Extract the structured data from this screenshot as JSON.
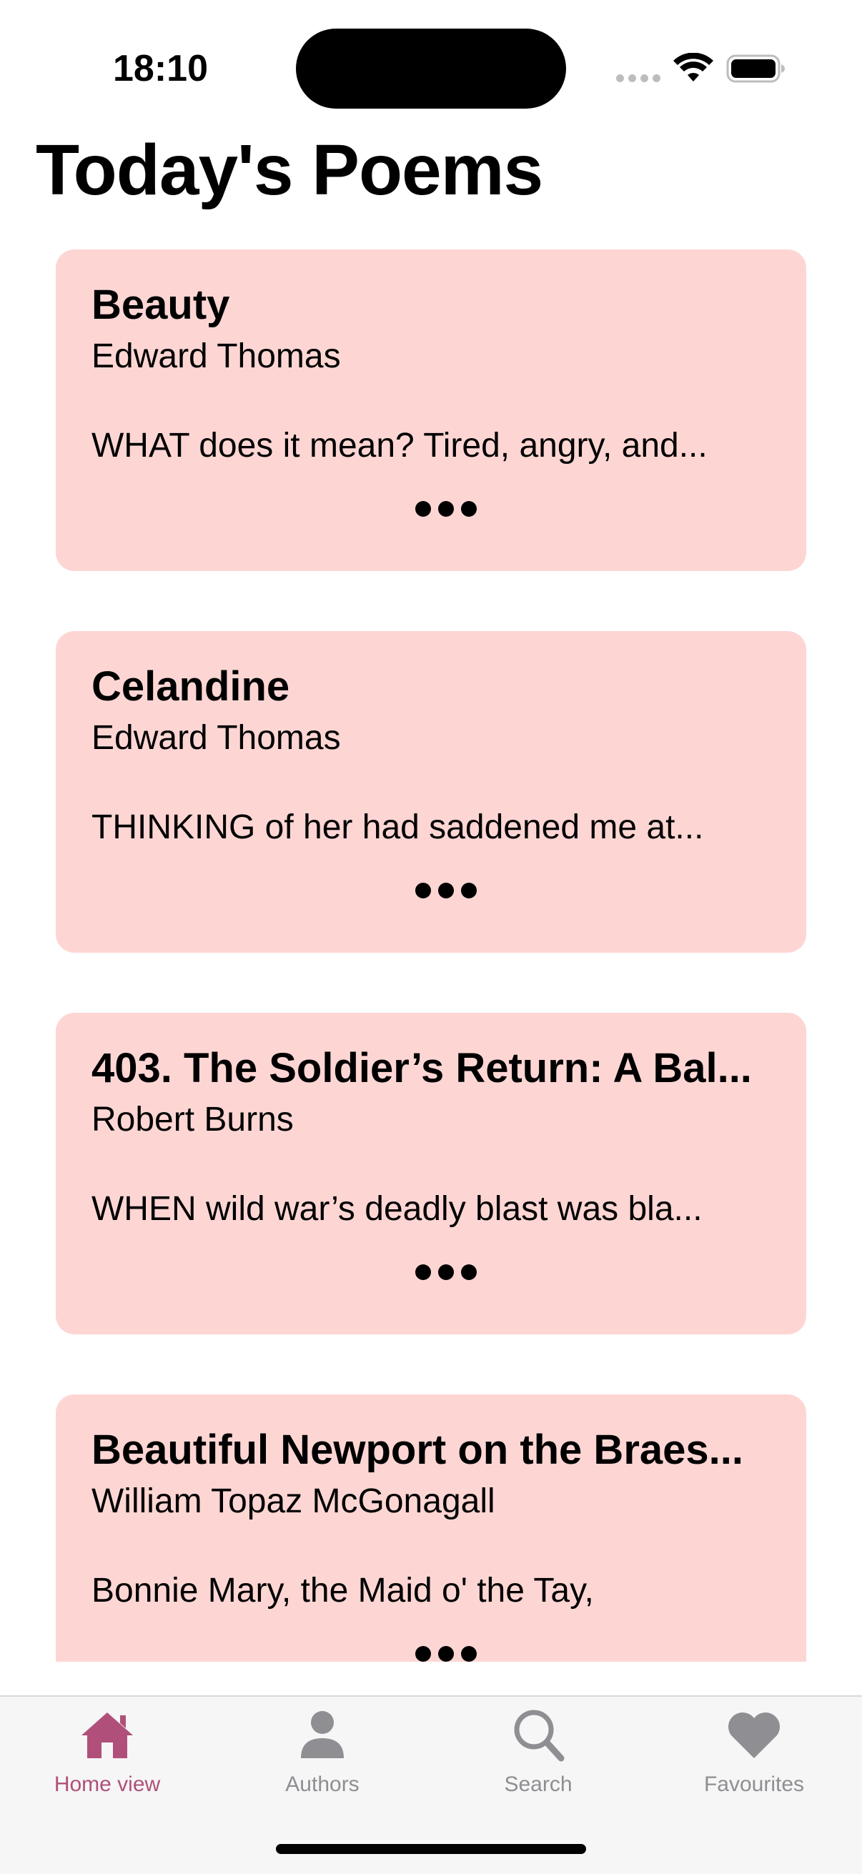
{
  "status_bar": {
    "time": "18:10"
  },
  "header": {
    "title": "Today's Poems"
  },
  "poems": [
    {
      "title": "Beauty",
      "author": "Edward Thomas",
      "excerpt": "WHAT does it mean? Tired, angry, and..."
    },
    {
      "title": "Celandine",
      "author": "Edward Thomas",
      "excerpt": "THINKING of her had saddened me at..."
    },
    {
      "title": "403. The Soldier’s Return: A Bal...",
      "author": "Robert Burns",
      "excerpt": "WHEN wild war’s deadly blast was bla..."
    },
    {
      "title": "Beautiful Newport on the Braes...",
      "author": "William Topaz McGonagall",
      "excerpt": "Bonnie Mary, the Maid o' the Tay,"
    }
  ],
  "tab_bar": {
    "tabs": [
      {
        "label": "Home view",
        "icon": "house-icon",
        "active": true
      },
      {
        "label": "Authors",
        "icon": "person-icon",
        "active": false
      },
      {
        "label": "Search",
        "icon": "magnifier-icon",
        "active": false
      },
      {
        "label": "Favourites",
        "icon": "heart-icon",
        "active": false
      }
    ]
  },
  "colors": {
    "card_background": "#fdd6d4",
    "accent": "#b0507a",
    "inactive": "#8e8e93"
  }
}
